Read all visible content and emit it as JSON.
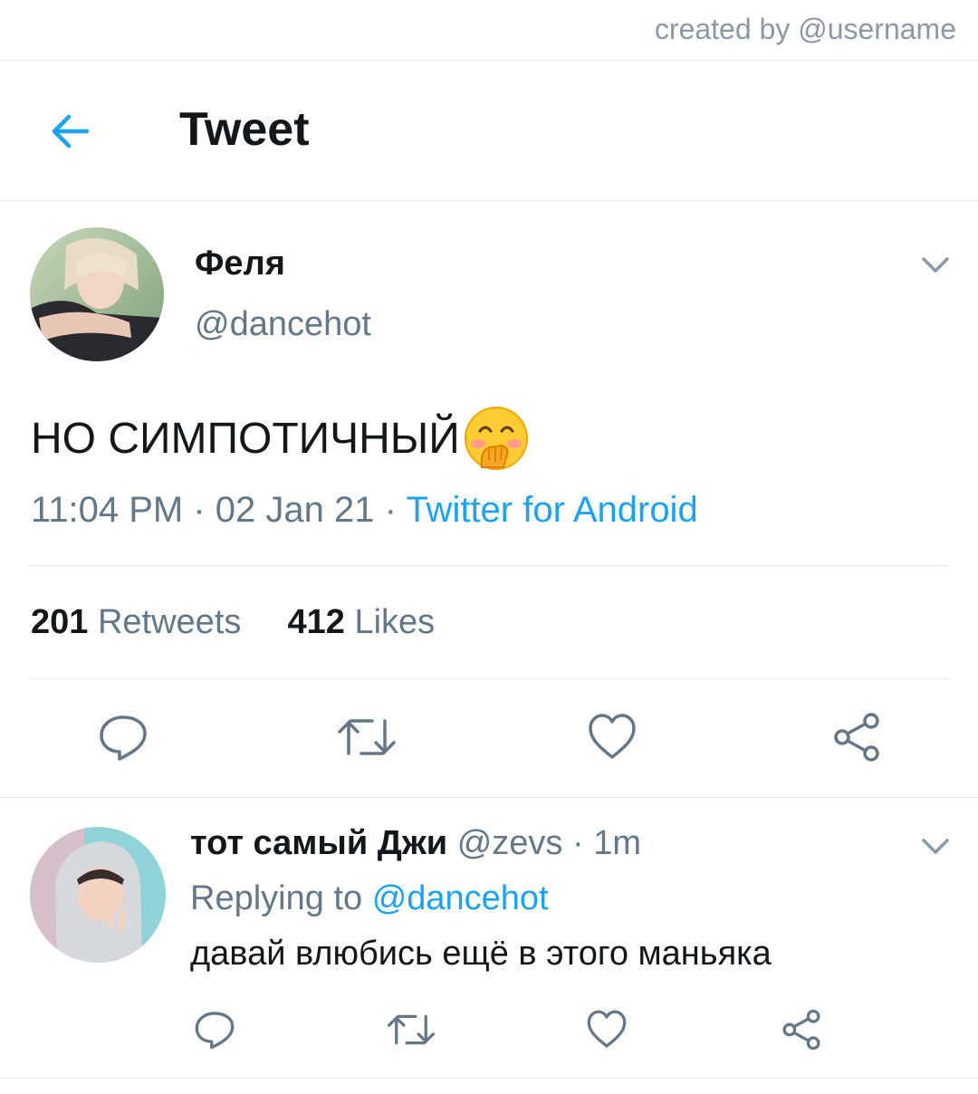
{
  "watermark": {
    "text": "created by @username"
  },
  "header": {
    "title": "Tweet",
    "back_icon": "arrow-left-icon"
  },
  "tweet": {
    "display_name": "Феля",
    "handle": "@dancehot",
    "text": "НО СИМПОТИЧНЫЙ",
    "emoji": "face-with-hand-over-mouth",
    "time": "11:04 PM",
    "date": "02 Jan 21",
    "separator": " · ",
    "source": "Twitter for Android",
    "retweets": {
      "count": "201",
      "label": "Retweets"
    },
    "likes": {
      "count": "412",
      "label": "Likes"
    },
    "actions": [
      "reply-icon",
      "retweet-icon",
      "like-icon",
      "share-icon"
    ]
  },
  "reply": {
    "display_name": "тот самый Джи",
    "handle": "@zevs",
    "time": "1m",
    "separator": " · ",
    "replying_label": "Replying to",
    "replying_to": "@dancehot",
    "text": "давай влюбись ещё в этого маньяка",
    "actions": [
      "reply-icon",
      "retweet-icon",
      "like-icon",
      "share-icon"
    ]
  },
  "colors": {
    "accent": "#1da1f2",
    "text_primary": "#14171a",
    "text_secondary": "#657786",
    "divider": "#e1e8ed"
  }
}
